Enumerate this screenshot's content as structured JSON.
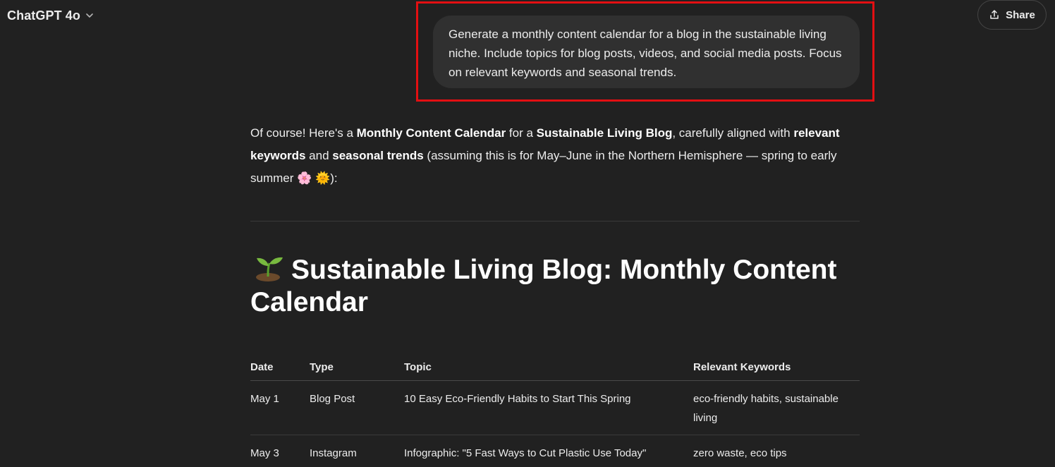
{
  "header": {
    "model_name": "ChatGPT 4o",
    "share_label": "Share"
  },
  "conversation": {
    "user_message": "Generate a monthly content calendar for a blog in the sustainable living niche. Include topics for blog posts, videos, and social media posts. Focus on relevant keywords and seasonal trends.",
    "assistant": {
      "intro": {
        "p1": "Of course! Here's a ",
        "b1": "Monthly Content Calendar",
        "p2": " for a ",
        "b2": "Sustainable Living Blog",
        "p3": ", carefully aligned with ",
        "b3": "relevant keywords",
        "p4": " and ",
        "b4": "seasonal trends",
        "p5": " (assuming this is for May–June in the Northern Hemisphere — spring to early summer ",
        "emoji1": "🌸",
        "emoji2": "🌞",
        "p6": "):"
      },
      "heading": "Sustainable Living Blog: Monthly Content Calendar",
      "table": {
        "headers": [
          "Date",
          "Type",
          "Topic",
          "Relevant Keywords"
        ],
        "rows": [
          [
            "May 1",
            "Blog Post",
            "10 Easy Eco-Friendly Habits to Start This Spring",
            "eco-friendly habits, sustainable living"
          ],
          [
            "May 3",
            "Instagram",
            "Infographic: \"5 Fast Ways to Cut Plastic Use Today\"",
            "zero waste, eco tips"
          ]
        ]
      }
    }
  },
  "icons": {
    "model_chevron": "chevron-down-icon",
    "share": "share-upload-icon",
    "heading_emoji": "seedling-icon"
  },
  "colors": {
    "background": "#212121",
    "bubble": "#303030",
    "highlight": "#e30f12"
  }
}
